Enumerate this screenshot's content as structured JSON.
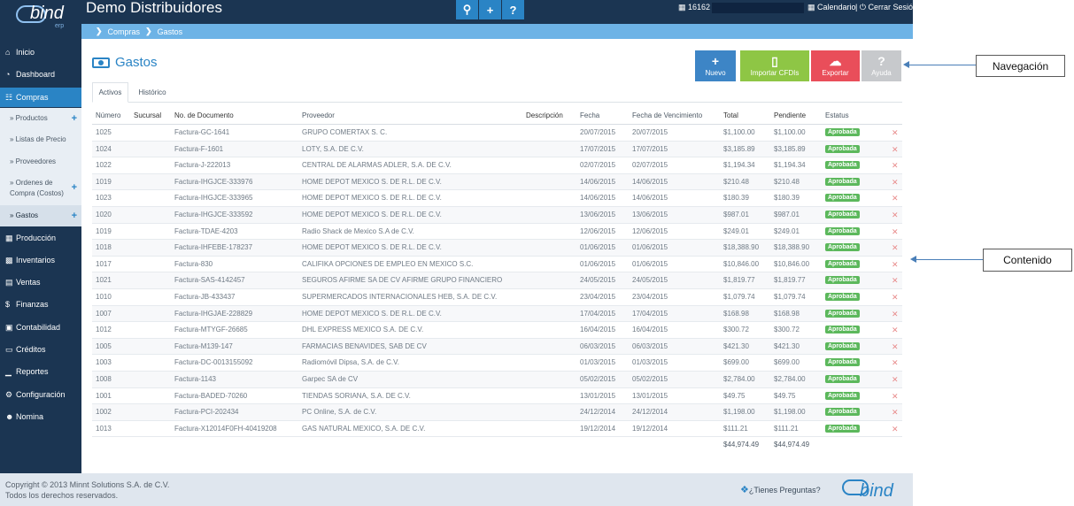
{
  "topbar": {
    "logo": "bind",
    "logo_sub": "erp",
    "title": "Demo Distribuidores",
    "actions": [
      "search-icon",
      "plus-icon",
      "question-icon"
    ],
    "ticket_count": "16162",
    "calendario": "Calendario",
    "logout": "Cerrar Sesión"
  },
  "breadcrumb": [
    "Compras",
    "Gastos"
  ],
  "sidebar": {
    "items": [
      {
        "label": "Inicio",
        "icon": "home-icon"
      },
      {
        "label": "Dashboard",
        "icon": "dashboard-icon"
      },
      {
        "label": "Compras",
        "icon": "cart-icon"
      },
      {
        "label": "Producción",
        "icon": "factory-icon"
      },
      {
        "label": "Inventarios",
        "icon": "truck-icon"
      },
      {
        "label": "Ventas",
        "icon": "sales-icon"
      },
      {
        "label": "Finanzas",
        "icon": "dollar-icon"
      },
      {
        "label": "Contabilidad",
        "icon": "book-icon"
      },
      {
        "label": "Créditos",
        "icon": "credit-card-icon"
      },
      {
        "label": "Reportes",
        "icon": "chart-icon"
      },
      {
        "label": "Configuración",
        "icon": "gears-icon"
      },
      {
        "label": "Nomina",
        "icon": "users-icon"
      }
    ],
    "compras_sub": [
      {
        "label": "» Productos"
      },
      {
        "label": "» Listas de Precio"
      },
      {
        "label": "» Proveedores"
      },
      {
        "label": "» Ordenes de",
        "label2": "Compra (Costos)"
      },
      {
        "label": "» Gastos"
      }
    ]
  },
  "page": {
    "title": "Gastos",
    "buttons": {
      "nuevo": "Nuevo",
      "importar": "Importar CFDIs",
      "exportar": "Exportar",
      "ayuda": "Ayuda"
    },
    "tabs": {
      "active": "Activos",
      "other": "Histórico"
    }
  },
  "table": {
    "headers": {
      "numero": "Número",
      "sucursal": "Sucursal",
      "documento": "No. de Documento",
      "proveedor": "Proveedor",
      "descripcion": "Descripción",
      "fecha": "Fecha",
      "vencimiento": "Fecha de Vencimiento",
      "total": "Total",
      "pendiente": "Pendiente",
      "estatus": "Estatus"
    },
    "rows": [
      {
        "numero": "1025",
        "documento": "Factura-GC-1641",
        "proveedor": "GRUPO COMERTAX S. C.",
        "fecha": "20/07/2015",
        "vencimiento": "20/07/2015",
        "total": "$1,100.00",
        "pendiente": "$1,100.00",
        "estatus": "Aprobada"
      },
      {
        "numero": "1024",
        "documento": "Factura-F-1601",
        "proveedor": "LOTY, S.A. DE C.V.",
        "fecha": "17/07/2015",
        "vencimiento": "17/07/2015",
        "total": "$3,185.89",
        "pendiente": "$3,185.89",
        "estatus": "Aprobada"
      },
      {
        "numero": "1022",
        "documento": "Factura-J-222013",
        "proveedor": "CENTRAL DE ALARMAS ADLER, S.A. DE C.V.",
        "fecha": "02/07/2015",
        "vencimiento": "02/07/2015",
        "total": "$1,194.34",
        "pendiente": "$1,194.34",
        "estatus": "Aprobada"
      },
      {
        "numero": "1019",
        "documento": "Factura-IHGJCE-333976",
        "proveedor": "HOME DEPOT MEXICO S. DE R.L. DE C.V.",
        "fecha": "14/06/2015",
        "vencimiento": "14/06/2015",
        "total": "$210.48",
        "pendiente": "$210.48",
        "estatus": "Aprobada"
      },
      {
        "numero": "1023",
        "documento": "Factura-IHGJCE-333965",
        "proveedor": "HOME DEPOT MEXICO S. DE R.L. DE C.V.",
        "fecha": "14/06/2015",
        "vencimiento": "14/06/2015",
        "total": "$180.39",
        "pendiente": "$180.39",
        "estatus": "Aprobada"
      },
      {
        "numero": "1020",
        "documento": "Factura-IHGJCE-333592",
        "proveedor": "HOME DEPOT MEXICO S. DE R.L. DE C.V.",
        "fecha": "13/06/2015",
        "vencimiento": "13/06/2015",
        "total": "$987.01",
        "pendiente": "$987.01",
        "estatus": "Aprobada"
      },
      {
        "numero": "1019",
        "documento": "Factura-TDAE-4203",
        "proveedor": "Radio Shack de Mexico S.A de C.V.",
        "fecha": "12/06/2015",
        "vencimiento": "12/06/2015",
        "total": "$249.01",
        "pendiente": "$249.01",
        "estatus": "Aprobada"
      },
      {
        "numero": "1018",
        "documento": "Factura-IHFEBE-178237",
        "proveedor": "HOME DEPOT MEXICO S. DE R.L. DE C.V.",
        "fecha": "01/06/2015",
        "vencimiento": "01/06/2015",
        "total": "$18,388.90",
        "pendiente": "$18,388.90",
        "estatus": "Aprobada"
      },
      {
        "numero": "1017",
        "documento": "Factura-830",
        "proveedor": "CALIFIKA OPCIONES DE EMPLEO EN MEXICO S.C.",
        "fecha": "01/06/2015",
        "vencimiento": "01/06/2015",
        "total": "$10,846.00",
        "pendiente": "$10,846.00",
        "estatus": "Aprobada"
      },
      {
        "numero": "1021",
        "documento": "Factura-SAS-4142457",
        "proveedor": "SEGUROS AFIRME SA DE CV AFIRME GRUPO FINANCIERO",
        "fecha": "24/05/2015",
        "vencimiento": "24/05/2015",
        "total": "$1,819.77",
        "pendiente": "$1,819.77",
        "estatus": "Aprobada"
      },
      {
        "numero": "1010",
        "documento": "Factura-JB-433437",
        "proveedor": "SUPERMERCADOS INTERNACIONALES HEB, S.A. DE C.V.",
        "fecha": "23/04/2015",
        "vencimiento": "23/04/2015",
        "total": "$1,079.74",
        "pendiente": "$1,079.74",
        "estatus": "Aprobada"
      },
      {
        "numero": "1007",
        "documento": "Factura-IHGJAE-228829",
        "proveedor": "HOME DEPOT MEXICO S. DE R.L. DE C.V.",
        "fecha": "17/04/2015",
        "vencimiento": "17/04/2015",
        "total": "$168.98",
        "pendiente": "$168.98",
        "estatus": "Aprobada"
      },
      {
        "numero": "1012",
        "documento": "Factura-MTYGF-26685",
        "proveedor": "DHL EXPRESS MEXICO S.A. DE C.V.",
        "fecha": "16/04/2015",
        "vencimiento": "16/04/2015",
        "total": "$300.72",
        "pendiente": "$300.72",
        "estatus": "Aprobada"
      },
      {
        "numero": "1005",
        "documento": "Factura-M139-147",
        "proveedor": "FARMACIAS BENAVIDES, SAB DE CV",
        "fecha": "06/03/2015",
        "vencimiento": "06/03/2015",
        "total": "$421.30",
        "pendiente": "$421.30",
        "estatus": "Aprobada"
      },
      {
        "numero": "1003",
        "documento": "Factura-DC-0013155092",
        "proveedor": "Radiomóvil Dipsa, S.A. de C.V.",
        "fecha": "01/03/2015",
        "vencimiento": "01/03/2015",
        "total": "$699.00",
        "pendiente": "$699.00",
        "estatus": "Aprobada"
      },
      {
        "numero": "1008",
        "documento": "Factura-1143",
        "proveedor": "Garpec SA de CV",
        "fecha": "05/02/2015",
        "vencimiento": "05/02/2015",
        "total": "$2,784.00",
        "pendiente": "$2,784.00",
        "estatus": "Aprobada"
      },
      {
        "numero": "1001",
        "documento": "Factura-BADED-70260",
        "proveedor": "TIENDAS SORIANA, S.A. DE C.V.",
        "fecha": "13/01/2015",
        "vencimiento": "13/01/2015",
        "total": "$49.75",
        "pendiente": "$49.75",
        "estatus": "Aprobada"
      },
      {
        "numero": "1002",
        "documento": "Factura-PCI-202434",
        "proveedor": "PC Online, S.A. de C.V.",
        "fecha": "24/12/2014",
        "vencimiento": "24/12/2014",
        "total": "$1,198.00",
        "pendiente": "$1,198.00",
        "estatus": "Aprobada"
      },
      {
        "numero": "1013",
        "documento": "Factura-X12014F0FH-40419208",
        "proveedor": "GAS NATURAL MEXICO, S.A. DE C.V.",
        "fecha": "19/12/2014",
        "vencimiento": "19/12/2014",
        "total": "$111.21",
        "pendiente": "$111.21",
        "estatus": "Aprobada"
      }
    ],
    "totals": {
      "total": "$44,974.49",
      "pendiente": "$44,974.49"
    }
  },
  "footer": {
    "copyright": "Copyright © 2013 Minnt Solutions S.A. de C.V.",
    "rights": "Todos los derechos reservados.",
    "preguntas": "¿Tienes Preguntas?",
    "logo": "bind"
  },
  "annotations": {
    "navegacion": "Navegación",
    "contenido": "Contenido"
  },
  "colors": {
    "topbar": "#1b3552",
    "accent": "#2a84c5",
    "breadcrumb": "#6db3e6",
    "nuevo": "#3d85c6",
    "importar": "#8ec645",
    "exportar": "#e94e5a",
    "ayuda": "#c7c9cc",
    "badge": "#5cb85c"
  }
}
